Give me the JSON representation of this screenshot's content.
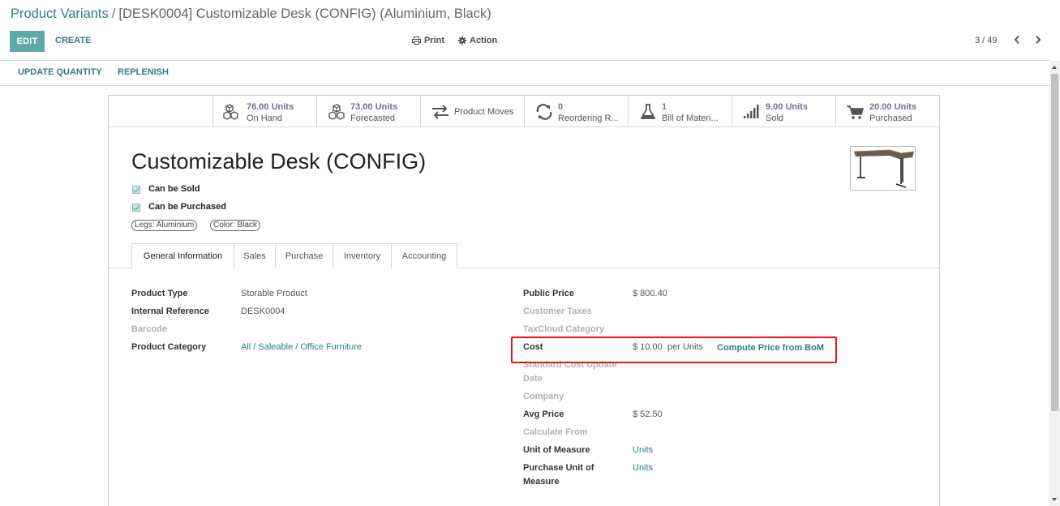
{
  "breadcrumb": {
    "parent": "Product Variants",
    "separator": "/",
    "current": "[DESK0004] Customizable Desk (CONFIG) (Aluminium, Black)"
  },
  "toolbar": {
    "edit": "EDIT",
    "create": "CREATE",
    "print": "Print",
    "action": "Action",
    "pager": "3 / 49"
  },
  "statusbar": {
    "update_quantity": "UPDATE QUANTITY",
    "replenish": "REPLENISH"
  },
  "smart_buttons": [
    {
      "icon": "cubes-icon",
      "value": "76.00 Units",
      "label": "On Hand"
    },
    {
      "icon": "cubes-icon",
      "value": "73.00 Units",
      "label": "Forecasted"
    },
    {
      "icon": "exchange-icon",
      "value": "",
      "label": "Product Moves"
    },
    {
      "icon": "refresh-icon",
      "value": "0",
      "label": "Reordering R..."
    },
    {
      "icon": "flask-icon",
      "value": "1",
      "label": "Bill of Materi..."
    },
    {
      "icon": "signal-icon",
      "value": "9.00 Units",
      "label": "Sold"
    },
    {
      "icon": "cart-icon",
      "value": "20.00 Units",
      "label": "Purchased"
    }
  ],
  "product": {
    "name": "Customizable Desk (CONFIG)",
    "can_be_sold": "Can be Sold",
    "can_be_purchased": "Can be Purchased",
    "tags": [
      "Legs: Aluminium",
      "Color: Black"
    ]
  },
  "tabs": [
    "General Information",
    "Sales",
    "Purchase",
    "Inventory",
    "Accounting"
  ],
  "left_fields": {
    "product_type": {
      "label": "Product Type",
      "value": "Storable Product"
    },
    "internal_reference": {
      "label": "Internal Reference",
      "value": "DESK0004"
    },
    "barcode": {
      "label": "Barcode",
      "value": ""
    },
    "product_category": {
      "label": "Product Category",
      "value": "All / Saleable / Office Furniture"
    }
  },
  "right_fields": {
    "public_price": {
      "label": "Public Price",
      "value": "$ 800.40"
    },
    "customer_taxes": {
      "label": "Customer Taxes",
      "value": ""
    },
    "taxcloud_category": {
      "label": "TaxCloud Category",
      "value": ""
    },
    "cost": {
      "label": "Cost",
      "value": "$ 10.00",
      "unit": "per Units",
      "action": "Compute Price from BoM"
    },
    "standard_cost_update_date": {
      "label_line1": "Standard Cost Update",
      "label_line2": "Date"
    },
    "company": {
      "label": "Company",
      "value": ""
    },
    "avg_price": {
      "label": "Avg Price",
      "value": "$ 52.50"
    },
    "calculate_from": {
      "label": "Calculate From",
      "value": ""
    },
    "unit_of_measure": {
      "label": "Unit of Measure",
      "value": "Units"
    },
    "purchase_uom": {
      "label_line1": "Purchase Unit of",
      "label_line2": "Measure",
      "value": "Units"
    }
  },
  "colors": {
    "primary": "#5eaaa6",
    "link": "#2f7f82",
    "stat_value": "#7c6b93",
    "highlight": "#e0141e"
  }
}
